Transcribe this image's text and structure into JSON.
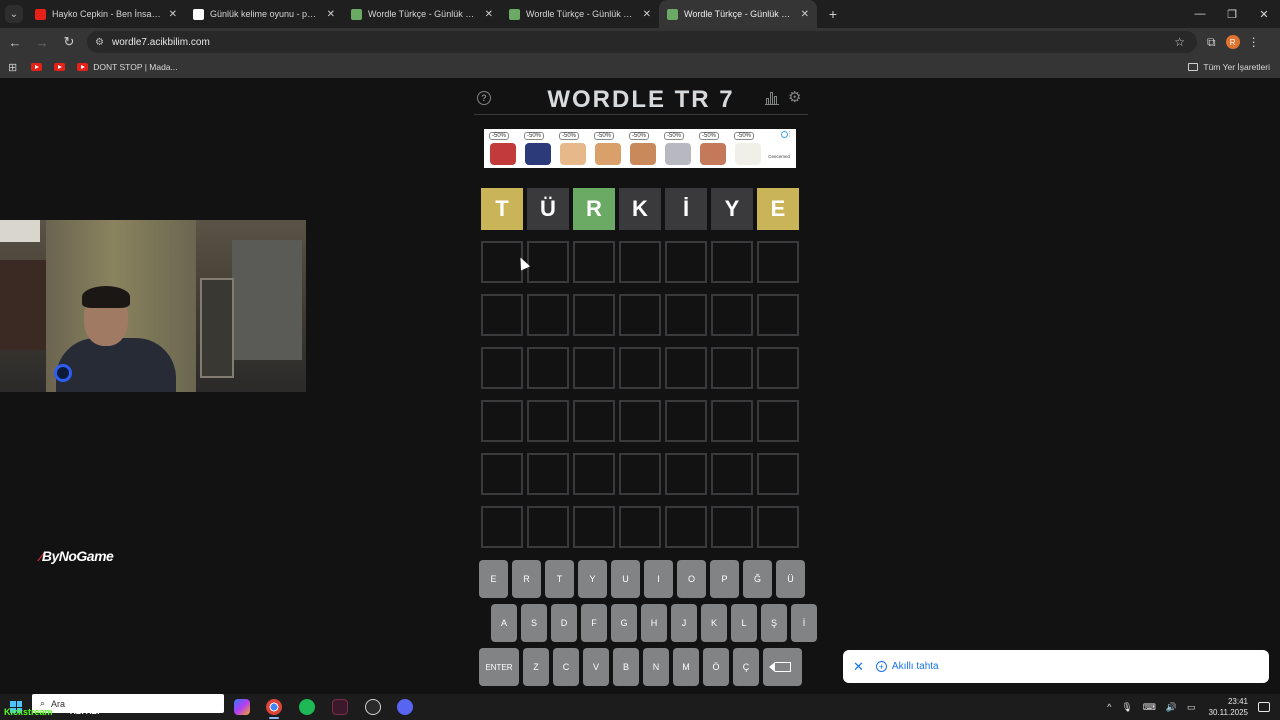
{
  "browser": {
    "tabs": [
      {
        "title": "Hayko Cepkin - Ben İnsan Değil",
        "favicon_color": "#e62117",
        "active": false
      },
      {
        "title": "Günlük kelime oyunu - parolla",
        "favicon_color": "#ffffff",
        "active": false
      },
      {
        "title": "Wordle Türkçe - Günlük Kelime",
        "favicon_color": "#6aaa64",
        "active": false
      },
      {
        "title": "Wordle Türkçe - Günlük Kelime",
        "favicon_color": "#6aaa64",
        "active": false
      },
      {
        "title": "Wordle Türkçe - Günlük Kelime",
        "favicon_color": "#6aaa64",
        "active": true
      }
    ],
    "tab_close": "✕",
    "new_tab": "+",
    "url": "wordle7.acikbilim.com",
    "profile_initial": "R",
    "bookmarks": [
      {
        "label": ""
      },
      {
        "label": ""
      },
      {
        "label": "DONT STOP | Mada..."
      }
    ],
    "all_bookmarks": "Tüm Yer İşaretleri"
  },
  "game": {
    "title": "WORDLE TR 7",
    "ad_badges": [
      "-50%",
      "-50%",
      "-50%",
      "-50%",
      "-50%",
      "-50%",
      "-50%",
      "-50%"
    ],
    "ad_brand": "Ceecemed",
    "board": [
      [
        {
          "l": "T",
          "s": "present"
        },
        {
          "l": "Ü",
          "s": "absent"
        },
        {
          "l": "R",
          "s": "correct"
        },
        {
          "l": "K",
          "s": "absent"
        },
        {
          "l": "İ",
          "s": "absent"
        },
        {
          "l": "Y",
          "s": "absent"
        },
        {
          "l": "E",
          "s": "present"
        }
      ],
      [
        {
          "l": "",
          "s": "empty"
        },
        {
          "l": "",
          "s": "empty"
        },
        {
          "l": "",
          "s": "empty"
        },
        {
          "l": "",
          "s": "empty"
        },
        {
          "l": "",
          "s": "empty"
        },
        {
          "l": "",
          "s": "empty"
        },
        {
          "l": "",
          "s": "empty"
        }
      ],
      [
        {
          "l": "",
          "s": "empty"
        },
        {
          "l": "",
          "s": "empty"
        },
        {
          "l": "",
          "s": "empty"
        },
        {
          "l": "",
          "s": "empty"
        },
        {
          "l": "",
          "s": "empty"
        },
        {
          "l": "",
          "s": "empty"
        },
        {
          "l": "",
          "s": "empty"
        }
      ],
      [
        {
          "l": "",
          "s": "empty"
        },
        {
          "l": "",
          "s": "empty"
        },
        {
          "l": "",
          "s": "empty"
        },
        {
          "l": "",
          "s": "empty"
        },
        {
          "l": "",
          "s": "empty"
        },
        {
          "l": "",
          "s": "empty"
        },
        {
          "l": "",
          "s": "empty"
        }
      ],
      [
        {
          "l": "",
          "s": "empty"
        },
        {
          "l": "",
          "s": "empty"
        },
        {
          "l": "",
          "s": "empty"
        },
        {
          "l": "",
          "s": "empty"
        },
        {
          "l": "",
          "s": "empty"
        },
        {
          "l": "",
          "s": "empty"
        },
        {
          "l": "",
          "s": "empty"
        }
      ],
      [
        {
          "l": "",
          "s": "empty"
        },
        {
          "l": "",
          "s": "empty"
        },
        {
          "l": "",
          "s": "empty"
        },
        {
          "l": "",
          "s": "empty"
        },
        {
          "l": "",
          "s": "empty"
        },
        {
          "l": "",
          "s": "empty"
        },
        {
          "l": "",
          "s": "empty"
        }
      ],
      [
        {
          "l": "",
          "s": "empty"
        },
        {
          "l": "",
          "s": "empty"
        },
        {
          "l": "",
          "s": "empty"
        },
        {
          "l": "",
          "s": "empty"
        },
        {
          "l": "",
          "s": "empty"
        },
        {
          "l": "",
          "s": "empty"
        },
        {
          "l": "",
          "s": "empty"
        }
      ]
    ],
    "keyboard": [
      [
        {
          "k": "E",
          "s": "present"
        },
        {
          "k": "R",
          "s": "correct"
        },
        {
          "k": "T",
          "s": "present"
        },
        {
          "k": "Y",
          "s": "absent"
        },
        {
          "k": "U",
          "s": "unused"
        },
        {
          "k": "I",
          "s": "unused"
        },
        {
          "k": "O",
          "s": "unused"
        },
        {
          "k": "P",
          "s": "unused"
        },
        {
          "k": "Ğ",
          "s": "unused"
        },
        {
          "k": "Ü",
          "s": "absent"
        }
      ],
      [
        {
          "k": "A",
          "s": "unused"
        },
        {
          "k": "S",
          "s": "unused"
        },
        {
          "k": "D",
          "s": "unused"
        },
        {
          "k": "F",
          "s": "unused"
        },
        {
          "k": "G",
          "s": "unused"
        },
        {
          "k": "H",
          "s": "unused"
        },
        {
          "k": "J",
          "s": "unused"
        },
        {
          "k": "K",
          "s": "absent"
        },
        {
          "k": "L",
          "s": "unused"
        },
        {
          "k": "Ş",
          "s": "unused"
        },
        {
          "k": "İ",
          "s": "absent"
        }
      ],
      [
        {
          "k": "ENTER",
          "s": "unused"
        },
        {
          "k": "Z",
          "s": "unused"
        },
        {
          "k": "C",
          "s": "unused"
        },
        {
          "k": "V",
          "s": "unused"
        },
        {
          "k": "B",
          "s": "unused"
        },
        {
          "k": "N",
          "s": "unused"
        },
        {
          "k": "M",
          "s": "unused"
        },
        {
          "k": "Ö",
          "s": "unused"
        },
        {
          "k": "Ç",
          "s": "unused"
        },
        {
          "k": "BACKSPACE",
          "s": "unused"
        }
      ]
    ],
    "colors": {
      "present": "#c9b458",
      "correct": "#6aaa64",
      "absent": "#3a3a3c",
      "unused": "#818384",
      "empty_border": "#3a3a3c"
    }
  },
  "overlay": {
    "sponsor": "ByNoGame",
    "toast_label": "Akıllı tahta"
  },
  "taskbar": {
    "search_placeholder": "Ara",
    "streamer_tag": "Kickstream",
    "now_playing": "ABI ABI",
    "time": "23:41",
    "date": "30.11.2025"
  }
}
